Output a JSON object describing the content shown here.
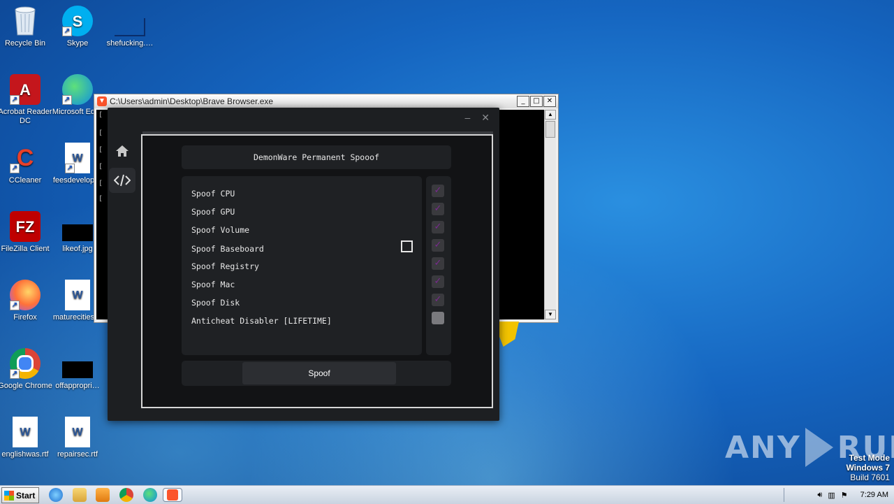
{
  "desktop": {
    "icons": [
      {
        "label": "Recycle Bin",
        "icon": "recycle-bin-icon"
      },
      {
        "label": "Skype",
        "icon": "skype-icon"
      },
      {
        "label": "shefucking.…",
        "icon": "blank-file-icon"
      },
      {
        "label": "Acrobat Reader DC",
        "icon": "acrobat-icon"
      },
      {
        "label": "Microsoft Ed…",
        "icon": "edge-icon"
      },
      {
        "label": "CCleaner",
        "icon": "ccleaner-icon"
      },
      {
        "label": "feesdevelop…",
        "icon": "word-doc-icon"
      },
      {
        "label": "FileZilla Client",
        "icon": "filezilla-icon"
      },
      {
        "label": "likeof.jpg",
        "icon": "image-file-icon"
      },
      {
        "label": "Firefox",
        "icon": "firefox-icon"
      },
      {
        "label": "maturecities…",
        "icon": "word-doc-icon"
      },
      {
        "label": "Google Chrome",
        "icon": "chrome-icon"
      },
      {
        "label": "offappropri…",
        "icon": "image-file-icon"
      },
      {
        "label": "englishwas.rtf",
        "icon": "word-doc-icon"
      },
      {
        "label": "repairsec.rtf",
        "icon": "word-doc-icon"
      }
    ]
  },
  "console": {
    "title": "C:\\Users\\admin\\Desktop\\Brave Browser.exe",
    "line_prefix": "[",
    "buttons": {
      "minimize": "_",
      "maximize": "□",
      "close": "✕"
    }
  },
  "app": {
    "title": "DemonWare Permanent Spooof",
    "options": [
      {
        "label": "Spoof CPU",
        "checked": true
      },
      {
        "label": "Spoof GPU",
        "checked": true
      },
      {
        "label": "Spoof Volume",
        "checked": true
      },
      {
        "label": "Spoof Baseboard",
        "checked": true
      },
      {
        "label": "Spoof Registry",
        "checked": true
      },
      {
        "label": "Spoof Mac",
        "checked": true
      },
      {
        "label": "Spoof Disk",
        "checked": true
      },
      {
        "label": "Anticheat Disabler  [LIFETIME]",
        "checked": false
      }
    ],
    "check_glyph": "✓",
    "spoof_button": "Spoof",
    "minimize": "–",
    "close": "✕",
    "accent_color": "#7a2a90"
  },
  "watermark": {
    "brand_left": "ANY",
    "brand_right": "RUN",
    "line1": "Test Mode",
    "line2": "Windows 7",
    "line3": "Build 7601"
  },
  "taskbar": {
    "start_label": "Start",
    "clock": "7:29 AM",
    "apps": [
      "ie-icon",
      "explorer-icon",
      "media-player-icon",
      "chrome-icon",
      "edge-icon",
      "brave-icon"
    ]
  }
}
